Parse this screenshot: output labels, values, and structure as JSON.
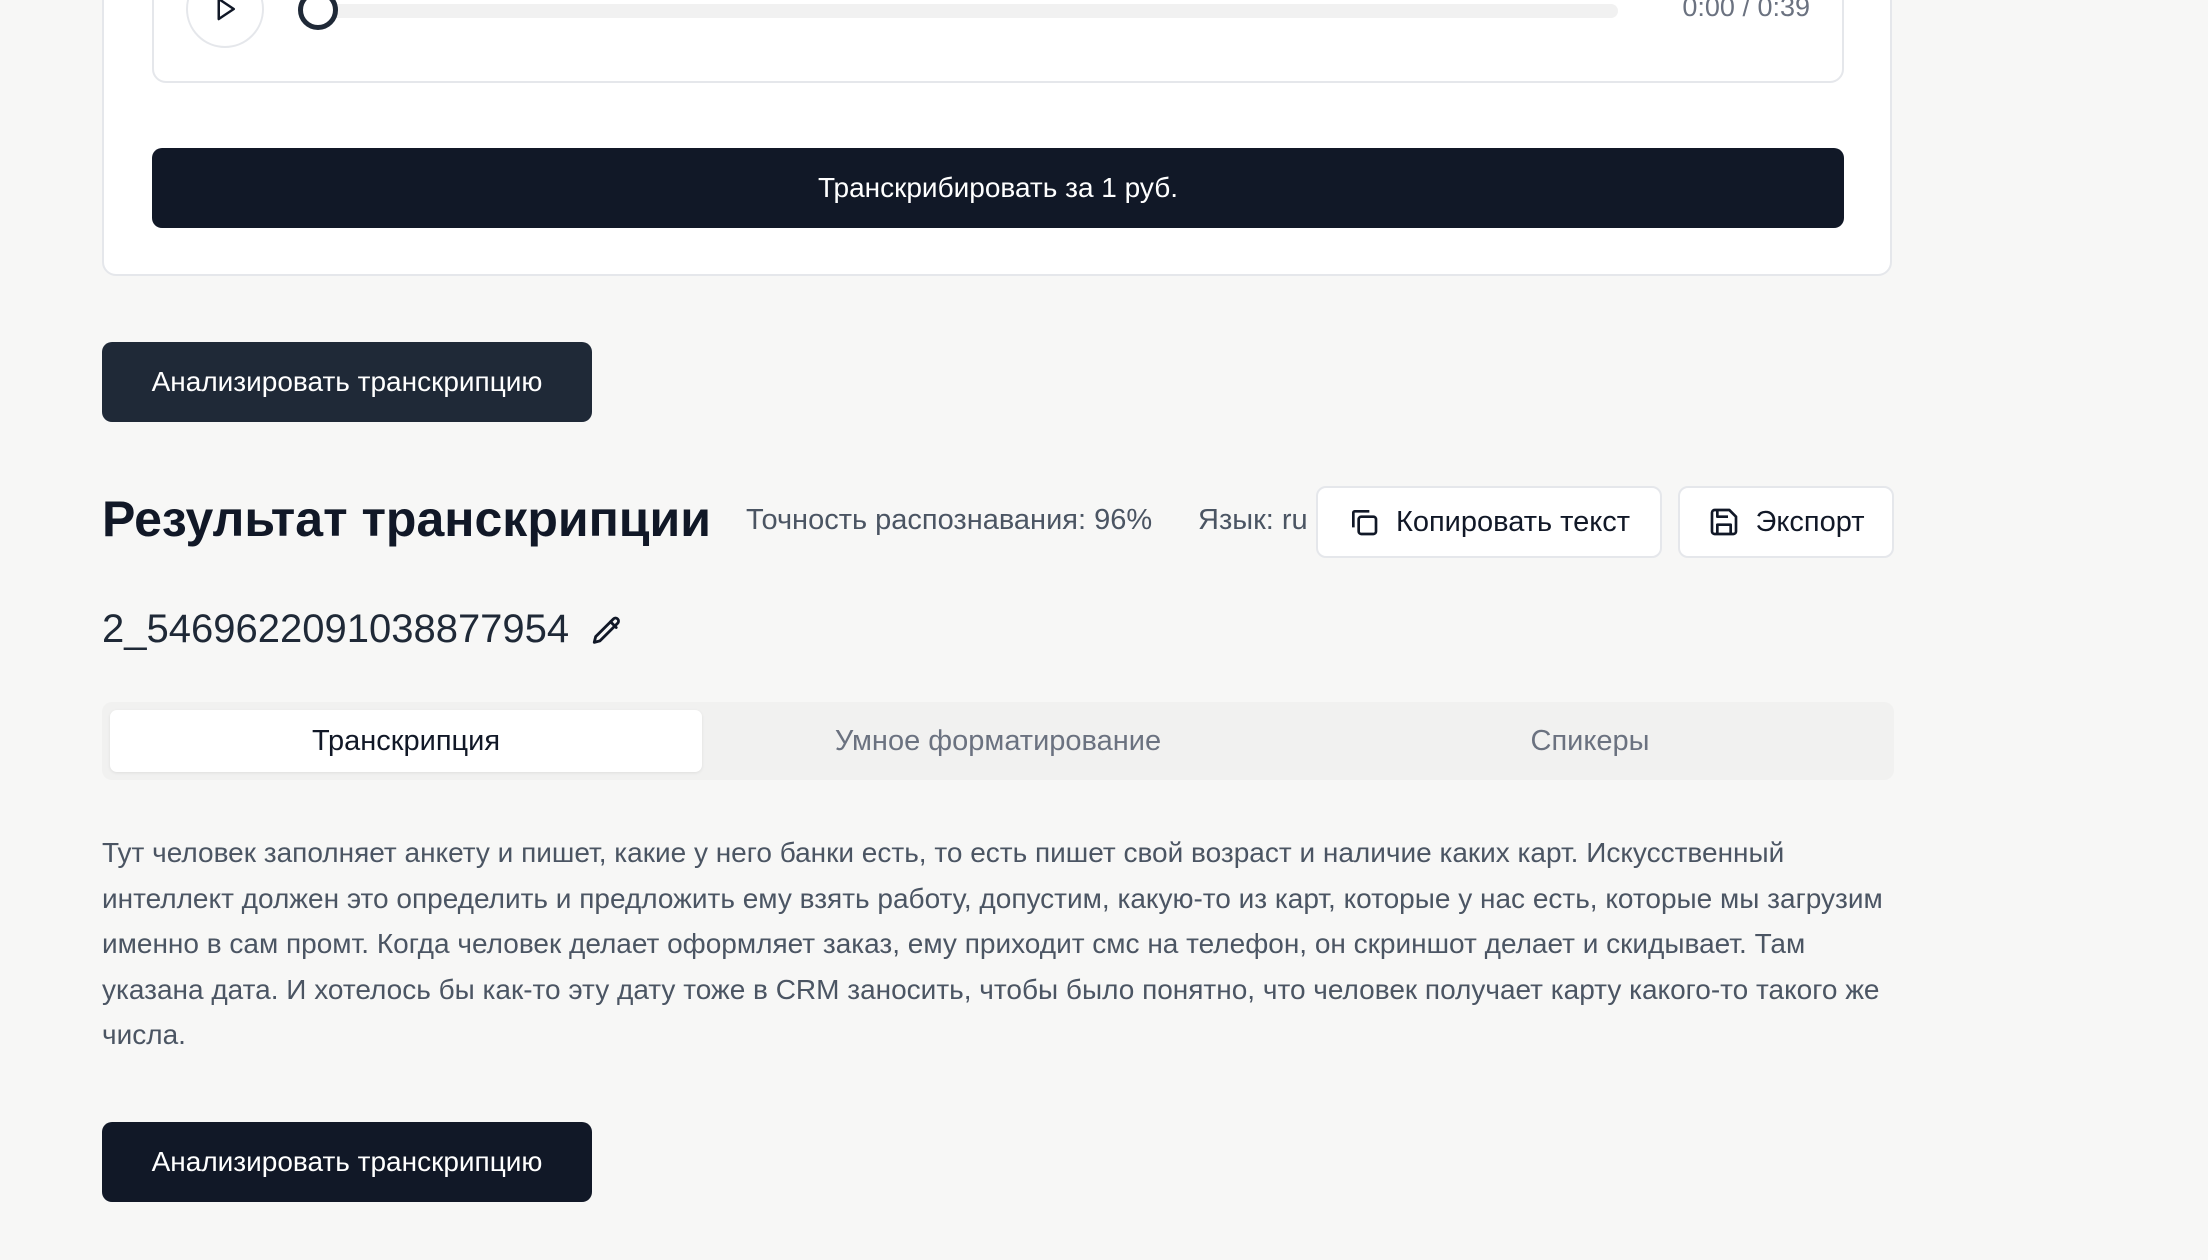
{
  "player": {
    "play_icon": "play-icon",
    "progress_fraction": 0,
    "time": "0:00 / 0:39"
  },
  "transcribe_button": "Транскрибировать за 1 руб.",
  "analyze_button_top": "Анализировать транскрипцию",
  "result": {
    "title": "Результат транскрипции",
    "accuracy": "Точность распознавания: 96%",
    "language": "Язык: ru",
    "copy_label": "Копировать текст",
    "copy_icon": "copy-icon",
    "export_label": "Экспорт",
    "export_icon": "save-icon"
  },
  "file": {
    "name": "2_5469622091038877954",
    "edit_icon": "pencil-icon"
  },
  "tabs": [
    {
      "label": "Транскрипция",
      "active": true
    },
    {
      "label": "Умное форматирование",
      "active": false
    },
    {
      "label": "Спикеры",
      "active": false
    }
  ],
  "transcript_text": "Тут человек заполняет анкету и пишет, какие у него банки есть, то есть пишет свой возраст и наличие каких карт. Искусственный интеллект должен это определить и предложить ему взять работу, допустим, какую-то из карт, которые у нас есть, которые мы загрузим именно в сам промт. Когда человек делает оформляет заказ, ему приходит смс на телефон, он скриншот делает и скидывает. Там указана дата. И хотелось бы как-то эту дату тоже в CRM заносить, чтобы было понятно, что человек получает карту какого-то такого же числа.",
  "analyze_button_bottom": "Анализировать транскрипцию",
  "colors": {
    "primary_button": "#111827",
    "secondary_button": "#1f2937",
    "background": "#f7f7f6"
  }
}
